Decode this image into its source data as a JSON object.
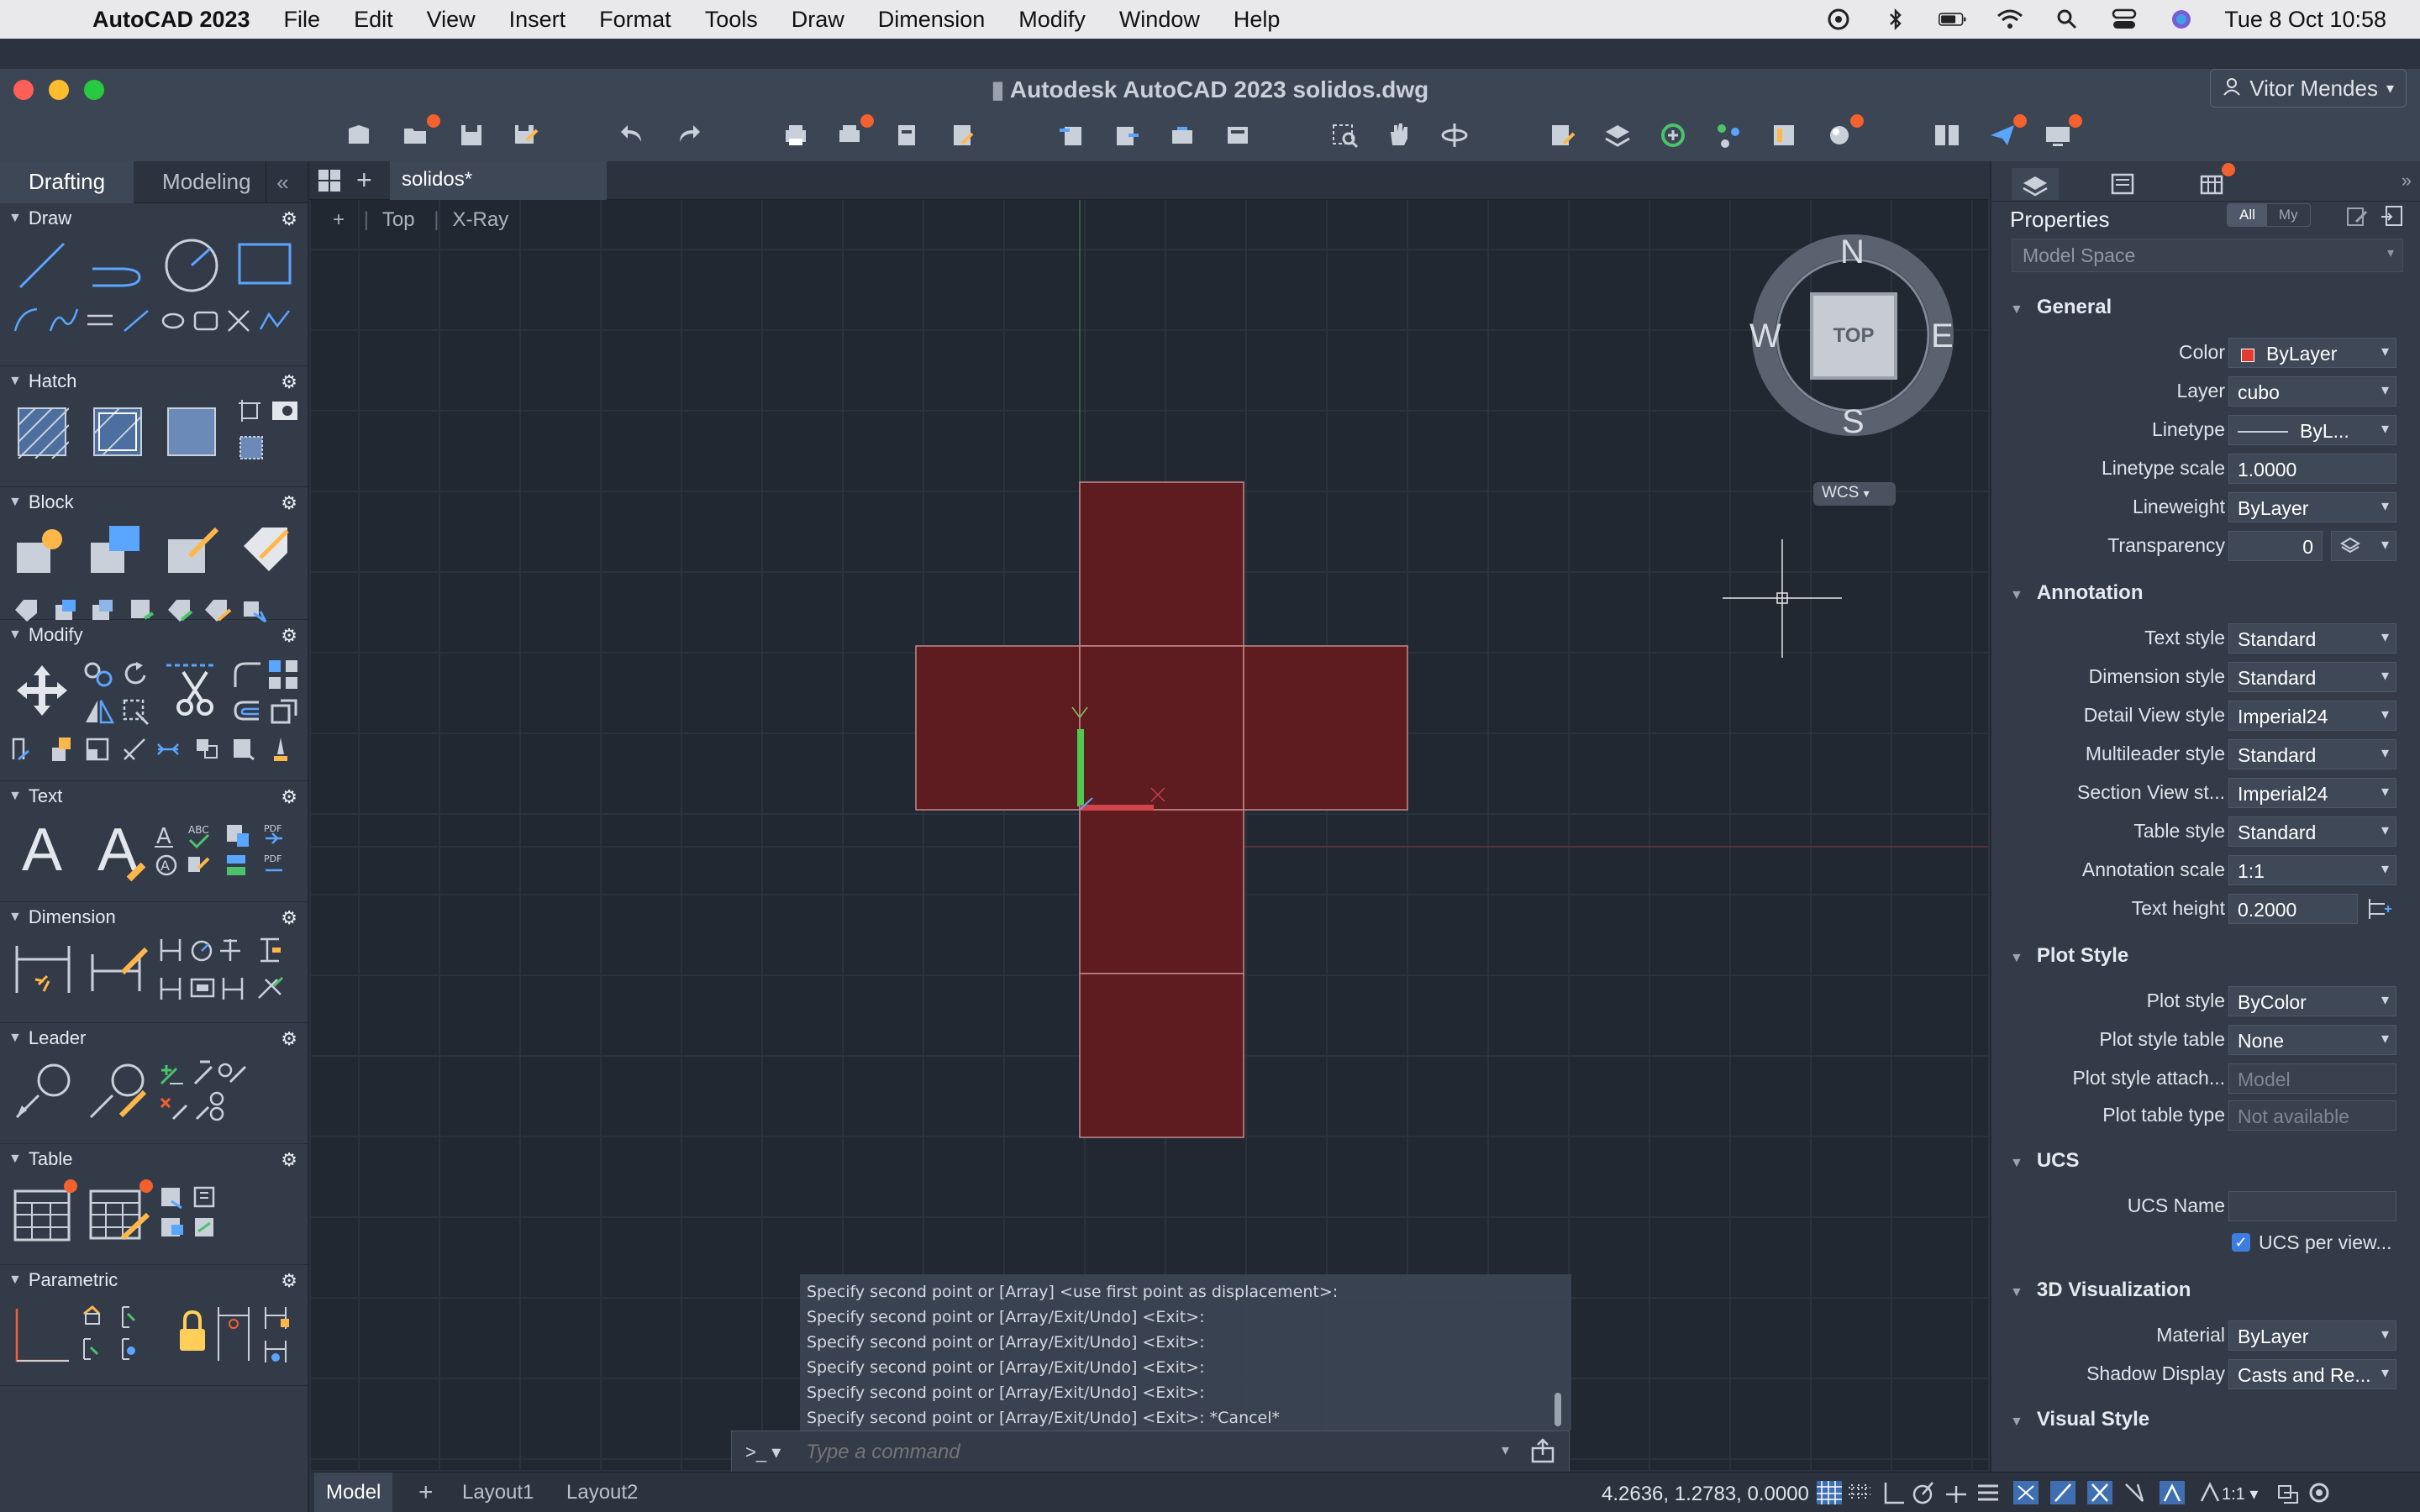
{
  "menubar": {
    "app": "AutoCAD 2023",
    "items": [
      "File",
      "Edit",
      "View",
      "Insert",
      "Format",
      "Tools",
      "Draw",
      "Dimension",
      "Modify",
      "Window",
      "Help"
    ],
    "clock": "Tue 8 Oct  10:58"
  },
  "window": {
    "title": "Autodesk AutoCAD 2023    solidos.dwg",
    "user": "Vitor Mendes"
  },
  "palette": {
    "tabs": [
      "Drafting",
      "Modeling"
    ],
    "sections": [
      "Draw",
      "Hatch",
      "Block",
      "Modify",
      "Text",
      "Dimension",
      "Leader",
      "Table",
      "Parametric"
    ]
  },
  "document": {
    "tab": "solidos*",
    "view_plus": "+",
    "view_name": "Top",
    "visual_style": "X-Ray"
  },
  "viewcube": {
    "north": "N",
    "south": "S",
    "east": "E",
    "west": "W",
    "face": "TOP",
    "ucs": "WCS"
  },
  "command": {
    "history": [
      "Specify second point or [Array] <use first point as displacement>:",
      "Specify second point or [Array/Exit/Undo] <Exit>:",
      "Specify second point or [Array/Exit/Undo] <Exit>:",
      "Specify second point or [Array/Exit/Undo] <Exit>:",
      "Specify second point or [Array/Exit/Undo] <Exit>:",
      "Specify second point or [Array/Exit/Undo] <Exit>: *Cancel*"
    ],
    "prompt": ">_",
    "placeholder": "Type a command"
  },
  "status": {
    "layouts": [
      "Model",
      "Layout1",
      "Layout2"
    ],
    "coords": "4.2636, 1.2783, 0.0000",
    "scale": "1:1"
  },
  "properties": {
    "title": "Properties",
    "filter_all": "All",
    "filter_my": "My",
    "space": "Model Space",
    "groups": {
      "general": "General",
      "annotation": "Annotation",
      "plot": "Plot Style",
      "ucs": "UCS",
      "vis3d": "3D Visualization",
      "visual": "Visual Style"
    },
    "general": {
      "color": {
        "label": "Color",
        "value": "ByLayer",
        "swatch": "#e23b2e"
      },
      "layer": {
        "label": "Layer",
        "value": "cubo"
      },
      "linetype": {
        "label": "Linetype",
        "value": "ByL..."
      },
      "linetype_scale": {
        "label": "Linetype scale",
        "value": "1.0000"
      },
      "lineweight": {
        "label": "Lineweight",
        "value": "ByLayer"
      },
      "transparency": {
        "label": "Transparency",
        "value": "0"
      }
    },
    "annotation": {
      "text_style": {
        "label": "Text style",
        "value": "Standard"
      },
      "dim_style": {
        "label": "Dimension style",
        "value": "Standard"
      },
      "detail_style": {
        "label": "Detail View style",
        "value": "Imperial24"
      },
      "mleader_style": {
        "label": "Multileader style",
        "value": "Standard"
      },
      "section_style": {
        "label": "Section View st...",
        "value": "Imperial24"
      },
      "table_style": {
        "label": "Table style",
        "value": "Standard"
      },
      "anno_scale": {
        "label": "Annotation scale",
        "value": "1:1"
      },
      "text_height": {
        "label": "Text height",
        "value": "0.2000"
      }
    },
    "plot": {
      "plot_style": {
        "label": "Plot style",
        "value": "ByColor"
      },
      "plot_table": {
        "label": "Plot style table",
        "value": "None"
      },
      "plot_attach": {
        "label": "Plot style attach...",
        "value": "Model"
      },
      "plot_type": {
        "label": "Plot table type",
        "value": "Not available"
      }
    },
    "ucs": {
      "name": {
        "label": "UCS Name",
        "value": ""
      },
      "per_view": {
        "label": "UCS per view..."
      }
    },
    "vis3d": {
      "material": {
        "label": "Material",
        "value": "ByLayer"
      },
      "shadow": {
        "label": "Shadow Display",
        "value": "Casts and Re..."
      }
    }
  },
  "colors": {
    "solid_fill": "#5e1c20",
    "solid_edge": "#c48a8a",
    "accent_dot": "#f2612e",
    "checkbox": "#3d7ee0"
  }
}
